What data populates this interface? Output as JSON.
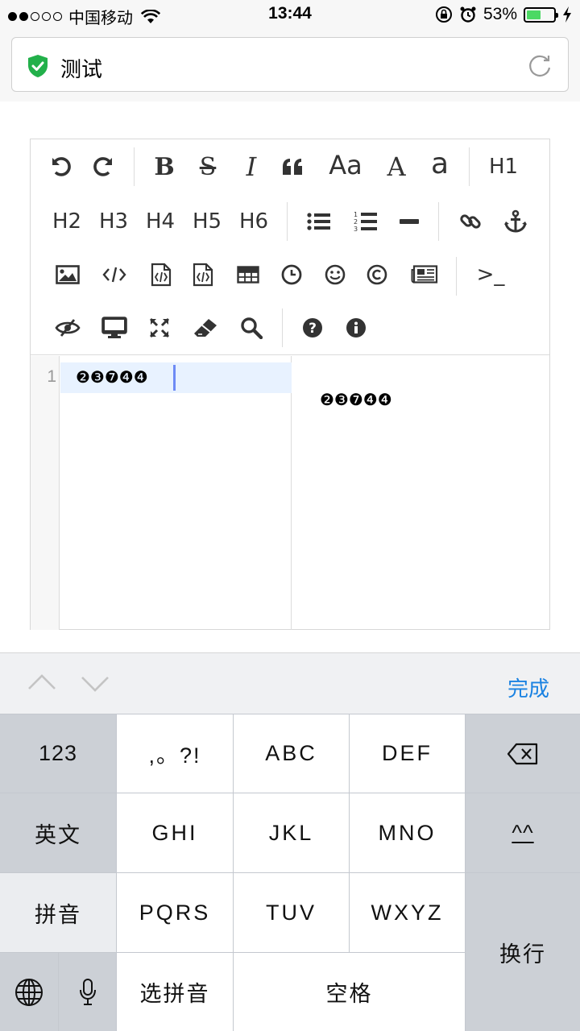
{
  "status_bar": {
    "carrier": "中国移动",
    "time": "13:44",
    "battery": "53%",
    "battery_level": 0.53,
    "icons": [
      "signal-dots",
      "wifi-icon",
      "rotation-lock-icon",
      "alarm-icon",
      "battery-icon",
      "charging-icon"
    ]
  },
  "address_bar": {
    "title": "测试",
    "secure_icon": "shield-check-icon",
    "reload_icon": "reload-icon"
  },
  "editor": {
    "toolbar_text_buttons": {
      "case_aa": "Aa",
      "upper_a": "A",
      "lower_a": "a",
      "h1": "H1",
      "h2": "H2",
      "h3": "H3",
      "h4": "H4",
      "h5": "H5",
      "h6": "H6",
      "terminal": ">_"
    },
    "toolbar_icons": [
      "undo-icon",
      "redo-icon",
      "bold-icon",
      "strikethrough-icon",
      "italic-icon",
      "quote-icon",
      "list-ul-icon",
      "list-ol-icon",
      "hr-icon",
      "link-icon",
      "anchor-icon",
      "image-icon",
      "code-icon",
      "code-file-icon",
      "code-file-alt-icon",
      "table-icon",
      "clock-icon",
      "smiley-icon",
      "copyright-icon",
      "newspaper-icon",
      "eye-slash-icon",
      "desktop-icon",
      "fullscreen-icon",
      "eraser-icon",
      "search-icon",
      "help-icon",
      "info-icon"
    ],
    "line_number": "1",
    "code_content": "❷❸❼❹❹",
    "preview_content": "❷❸❼❹❹",
    "accent_color": "#6e8bf5"
  },
  "accessory": {
    "done_label": "完成"
  },
  "keyboard": {
    "k_123": "123",
    "k_punct": ",。?!",
    "k_abc": "ABC",
    "k_def": "DEF",
    "k_english": "英文",
    "k_ghi": "GHI",
    "k_jkl": "JKL",
    "k_mno": "MNO",
    "k_emoticon": "^^",
    "k_pinyin": "拼音",
    "k_pqrs": "PQRS",
    "k_tuv": "TUV",
    "k_wxyz": "WXYZ",
    "k_return": "换行",
    "k_select_pinyin": "选拼音",
    "k_space": "空格"
  }
}
